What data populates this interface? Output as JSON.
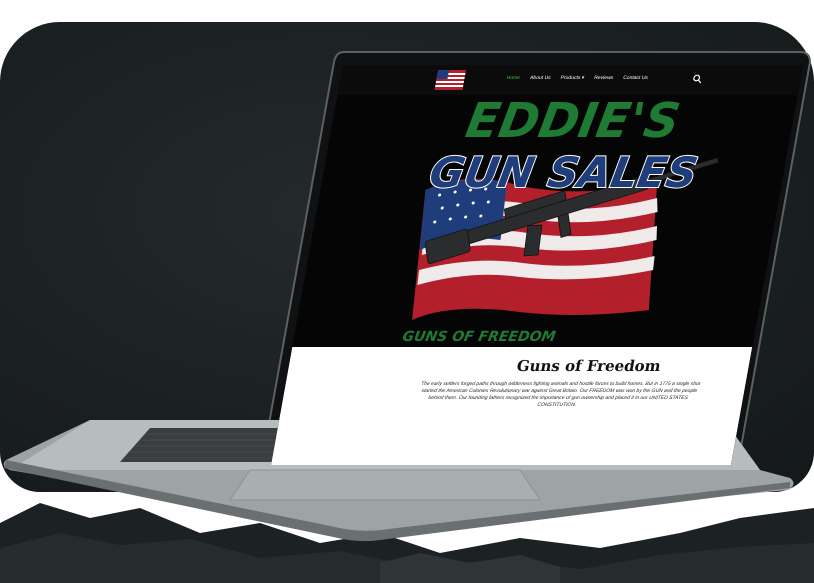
{
  "nav": {
    "links": [
      "Home",
      "About Us",
      "Products ▾",
      "Reviews",
      "Contact Us"
    ],
    "active_index": 0,
    "search_icon": "search-icon"
  },
  "hero": {
    "logo_text_top": "EDDIE'S",
    "logo_text_main": "GUN SALES",
    "logo_text_bottom": "GUNS OF FREEDOM"
  },
  "content": {
    "title": "Guns of Freedom",
    "body": "The early settlers forged paths through wilderness fighting animals and hostile forces to build homes. But in 1775 a single shot started the American Colonies Revolutionary war against Great Britain. Our FREEDOM was won by the GUN and the people behind them. Our founding fathers recognized the importance of gun ownership and placed it in our UNITED STATES CONSTITUTION."
  },
  "colors": {
    "accent_green": "#32c24d",
    "logo_green": "#1f7a34",
    "logo_blue": "#1e3d7a",
    "flag_red": "#b3202c"
  }
}
